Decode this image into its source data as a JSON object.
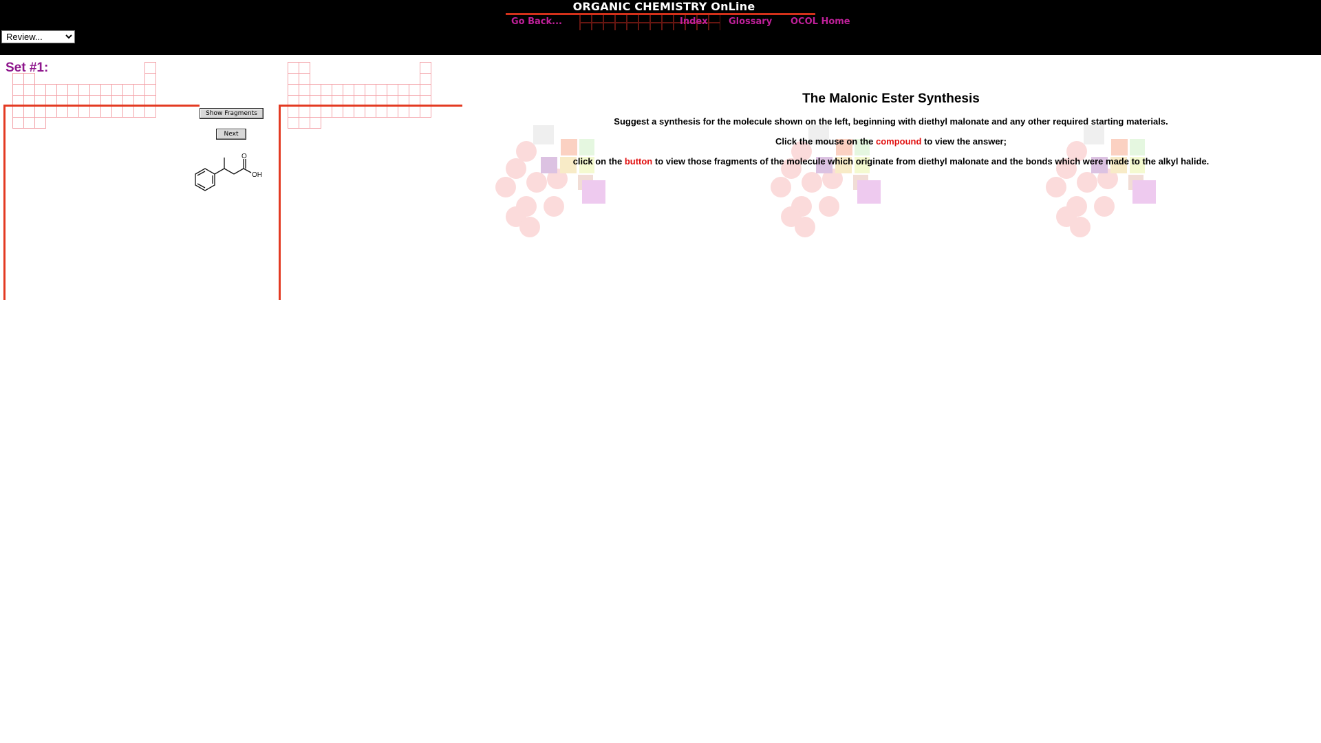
{
  "header": {
    "brand": "ORGANIC CHEMISTRY OnLine",
    "review_select": {
      "selected": "Review..."
    },
    "nav": {
      "go_back": "Go Back...",
      "index": "Index",
      "glossary": "Glossary",
      "home": "OCOL Home"
    }
  },
  "left_panel": {
    "set_title": "Set #1:",
    "show_fragments_button": "Show Fragments",
    "next_button": "Next",
    "molecule": {
      "carbonyl_o": "O",
      "hydroxyl": "OH"
    }
  },
  "content": {
    "title": "The Malonic Ester Synthesis",
    "instruction": "Suggest a synthesis for the molecule shown on the left, beginning with diethyl malonate and any other required starting materials.",
    "click_prefix": "Click the mouse on the ",
    "click_keyword": "compound",
    "click_suffix": " to view the answer;",
    "button_prefix": "click on the ",
    "button_keyword": "button",
    "button_suffix": " to view those fragments of the molecule which originate from diethyl malonate and the bonds which were made to the alkyl halide."
  },
  "colors": {
    "header_bg": "#000000",
    "nav_link": "#c0209a",
    "accent_red": "#e33a22",
    "set_title": "#8e168c",
    "keyword_red": "#e10f0f"
  }
}
